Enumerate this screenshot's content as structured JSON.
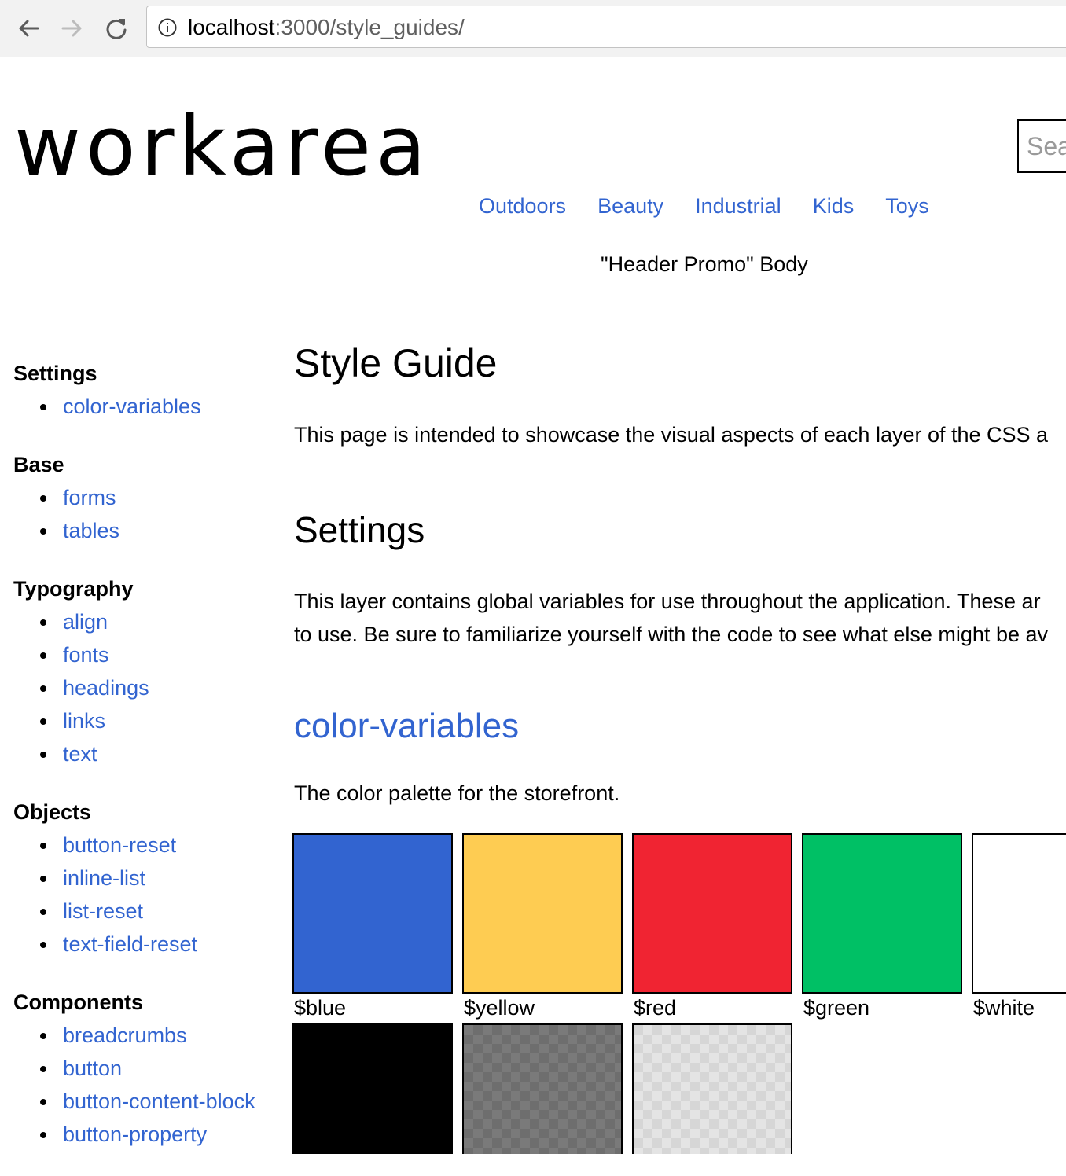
{
  "browser": {
    "url_host": "localhost",
    "url_path": ":3000/style_guides/"
  },
  "header": {
    "logo_text": "workarea",
    "search_placeholder": "Sea",
    "nav_items": [
      "Outdoors",
      "Beauty",
      "Industrial",
      "Kids",
      "Toys"
    ],
    "promo_text": "\"Header Promo\" Body"
  },
  "sidebar": {
    "sections": [
      {
        "title": "Settings",
        "items": [
          "color-variables"
        ]
      },
      {
        "title": "Base",
        "items": [
          "forms",
          "tables"
        ]
      },
      {
        "title": "Typography",
        "items": [
          "align",
          "fonts",
          "headings",
          "links",
          "text"
        ]
      },
      {
        "title": "Objects",
        "items": [
          "button-reset",
          "inline-list",
          "list-reset",
          "text-field-reset"
        ]
      },
      {
        "title": "Components",
        "items": [
          "breadcrumbs",
          "button",
          "button-content-block",
          "button-property"
        ]
      }
    ]
  },
  "main": {
    "title": "Style Guide",
    "intro": "This page is intended to showcase the visual aspects of each layer of the CSS a",
    "settings_title": "Settings",
    "settings_desc_line1": "This layer contains global variables for use throughout the application. These ar",
    "settings_desc_line2": "to use. Be sure to familiarize yourself with the code to see what else might be av",
    "color_variables_title": "color-variables",
    "palette_desc": "The color palette for the storefront.",
    "swatches": [
      {
        "label": "$blue",
        "color": "#3264d0"
      },
      {
        "label": "$yellow",
        "color": "#fecc52"
      },
      {
        "label": "$red",
        "color": "#f02432"
      },
      {
        "label": "$green",
        "color": "#00c065"
      },
      {
        "label": "$white",
        "color": "#ffffff"
      },
      {
        "label": "",
        "color": "#000000"
      },
      {
        "label": "",
        "color": "#7a7a7a",
        "pattern": "checker-dark"
      },
      {
        "label": "",
        "color": "#d6d6d6",
        "pattern": "checker-light"
      }
    ]
  },
  "colors": {
    "link": "#3264d0",
    "text": "#000000"
  }
}
